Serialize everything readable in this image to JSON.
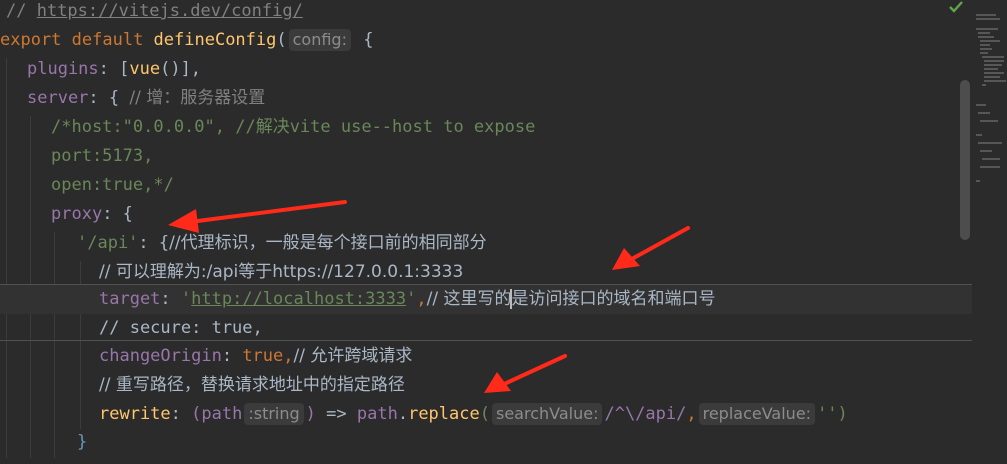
{
  "code": {
    "line1": {
      "comment_prefix": "// ",
      "url": "https://vitejs.dev/config/"
    },
    "line2": {
      "keyword_export": "export",
      "keyword_default": " default ",
      "fn": "defineConfig",
      "open": "(",
      "hint": "config:",
      "brace": " {"
    },
    "line3": {
      "prop": "plugins",
      "colon": ": [",
      "fn": "vue",
      "rest": "()],"
    },
    "line4": {
      "prop": "server",
      "colon": ": { ",
      "comment": "// 增：服务器设置"
    },
    "line5": {
      "comment": "/*host:\"0.0.0.0\", //解决vite use--host to expose"
    },
    "line6": {
      "comment": "port:5173,"
    },
    "line7": {
      "comment": "open:true,*/"
    },
    "line8": {
      "prop": "proxy",
      "colon": ": {"
    },
    "line9": {
      "str": "'/api'",
      "colon": ": {",
      "comment": "//代理标识，一般是每个接口前的相同部分"
    },
    "line10": {
      "comment": "// 可以理解为:/api等于https://127.0.0.1:3333"
    },
    "line11": {
      "prop": "target",
      "colon": ": ",
      "str_open": "'",
      "url": "http://localhost:3333",
      "str_close": "'",
      "comma": ",",
      "comment_a": "// 这里写的",
      "comment_b": "是访问接口的域名和端口号"
    },
    "line12": {
      "comment": "// secure: true,"
    },
    "line13": {
      "prop": "changeOrigin",
      "colon": ": ",
      "kw": "true",
      "comma": ",",
      "comment": "// 允许跨域请求"
    },
    "line14": {
      "comment": "// 重写路径，替换请求地址中的指定路径"
    },
    "line15": {
      "fn": "rewrite",
      "colon": ": ",
      "paren": "(",
      "param": "path",
      "hint_type": ":string",
      "paren_close": ")",
      "arrow": " => ",
      "obj": "path",
      "dot": ".",
      "method": "replace",
      "open": "(",
      "hint1": "searchValue:",
      "regex": "/^\\/api/",
      "comma": ",",
      "hint2": "replaceValue:",
      "str": "''",
      "close": ")"
    },
    "line16": {
      "brace": "}"
    }
  },
  "colors": {
    "background": "#2b2b2b",
    "arrow": "#ff2a1a"
  },
  "icons": {
    "inspection": "check-icon"
  }
}
